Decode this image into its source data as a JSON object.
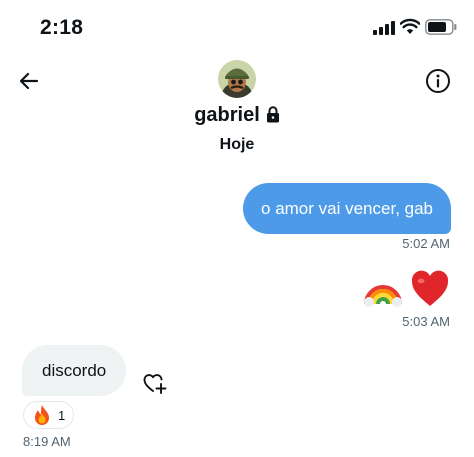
{
  "status_bar": {
    "time": "2:18",
    "icons": [
      "signal-icon",
      "wifi-icon",
      "battery-icon"
    ]
  },
  "header": {
    "back_icon": "arrow-left-icon",
    "info_icon": "info-icon",
    "profile_name": "gabriel",
    "locked_icon": "lock-icon",
    "date_label": "Hoje"
  },
  "messages": [
    {
      "direction": "outgoing",
      "text": "o amor vai vencer, gab",
      "time": "5:02 AM"
    },
    {
      "direction": "outgoing",
      "text": "🌈❤️",
      "time": "5:03 AM"
    },
    {
      "direction": "incoming",
      "text": "discordo",
      "time": "8:19 AM",
      "reaction": {
        "emoji": "🔥",
        "count": "1"
      }
    }
  ],
  "colors": {
    "outgoing_bubble": "#4c9ae8",
    "incoming_bubble": "#eff3f4",
    "timestamp": "#536471"
  }
}
